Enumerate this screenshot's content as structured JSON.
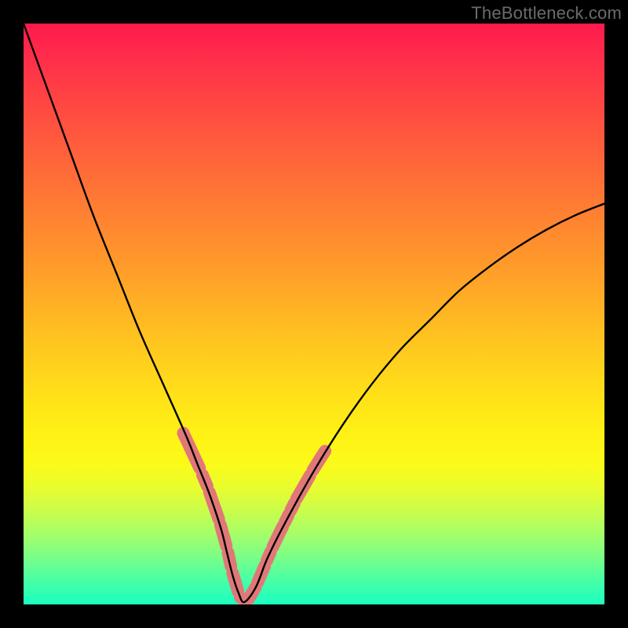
{
  "watermark": "TheBottleneck.com",
  "chart_data": {
    "type": "line",
    "title": "",
    "xlabel": "",
    "ylabel": "",
    "xlim": [
      0,
      100
    ],
    "ylim": [
      0,
      100
    ],
    "x": [
      0,
      4,
      8,
      12,
      16,
      20,
      24,
      28,
      30,
      32,
      34,
      35,
      36,
      37,
      38,
      40,
      42,
      45,
      50,
      55,
      60,
      65,
      70,
      75,
      80,
      85,
      90,
      95,
      100
    ],
    "y": [
      100,
      89,
      78,
      67,
      57,
      47,
      38,
      29,
      24,
      19,
      13,
      9,
      5,
      2,
      0.4,
      3,
      8,
      14,
      23,
      31,
      38,
      44,
      49,
      54,
      58,
      61.5,
      64.5,
      67,
      69
    ],
    "annotations": {
      "description": "pink capsule markers on lower section of V curve",
      "segments": [
        {
          "side": "left",
          "x": [
            27.5,
            30.3
          ],
          "y": [
            29.5,
            23.5
          ]
        },
        {
          "side": "left",
          "x": [
            30.8,
            31.6
          ],
          "y": [
            22.3,
            20.4
          ]
        },
        {
          "side": "left",
          "x": [
            32.0,
            33.6
          ],
          "y": [
            19.3,
            14.7
          ]
        },
        {
          "side": "left",
          "x": [
            33.9,
            34.9
          ],
          "y": [
            13.7,
            10.1
          ]
        },
        {
          "side": "left",
          "x": [
            35.2,
            35.7
          ],
          "y": [
            8.9,
            6.6
          ]
        },
        {
          "side": "left",
          "x": [
            36.0,
            36.9
          ],
          "y": [
            5.4,
            2.3
          ]
        },
        {
          "side": "floor",
          "x": [
            37.3,
            38.4
          ],
          "y": [
            1.2,
            0.6
          ]
        },
        {
          "side": "floor",
          "x": [
            38.8,
            39.9
          ],
          "y": [
            1.0,
            2.9
          ]
        },
        {
          "side": "right",
          "x": [
            40.3,
            41.5
          ],
          "y": [
            3.8,
            6.6
          ]
        },
        {
          "side": "right",
          "x": [
            41.9,
            42.5
          ],
          "y": [
            7.6,
            9.0
          ]
        },
        {
          "side": "right",
          "x": [
            42.9,
            44.6
          ],
          "y": [
            9.9,
            13.4
          ]
        },
        {
          "side": "right",
          "x": [
            45.0,
            45.6
          ],
          "y": [
            14.2,
            15.4
          ]
        },
        {
          "side": "right",
          "x": [
            46.0,
            46.6
          ],
          "y": [
            16.2,
            17.4
          ]
        },
        {
          "side": "right",
          "x": [
            47.0,
            49.3
          ],
          "y": [
            18.2,
            22.2
          ]
        },
        {
          "side": "right",
          "x": [
            49.8,
            51.9
          ],
          "y": [
            23.1,
            26.4
          ]
        }
      ]
    },
    "colors": {
      "curve": "#000000",
      "marker": "#e17878",
      "gradient_top": "#ff1a4d",
      "gradient_bottom": "#1affc0"
    }
  }
}
